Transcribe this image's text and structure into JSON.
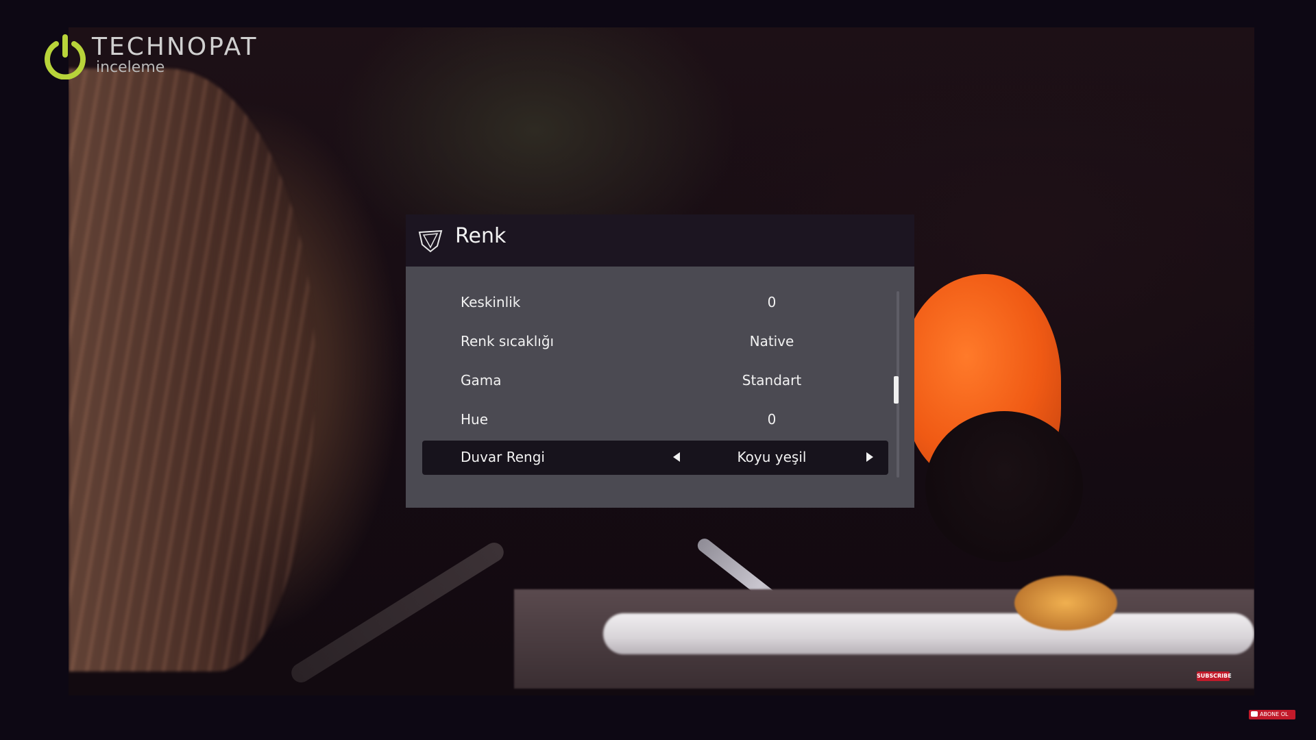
{
  "logo": {
    "brand": "TECHNOPAT",
    "sub": "inceleme",
    "accent_color": "#b8d43a",
    "icon": "power-icon"
  },
  "menu": {
    "title": "Renk",
    "icon": "shield-icon",
    "items": [
      {
        "label": "Keskinlik",
        "value": "0"
      },
      {
        "label": "Renk sıcaklığı",
        "value": "Native"
      },
      {
        "label": "Gama",
        "value": "Standart"
      },
      {
        "label": "Hue",
        "value": "0"
      },
      {
        "label": "Duvar Rengi",
        "value": "Koyu yeşil",
        "selected": true
      }
    ]
  },
  "badges": {
    "subscribe": "SUBSCRIBE",
    "abone": "ABONE OL"
  },
  "colors": {
    "header_bg": "#1c1521",
    "body_bg": "#4b4a52",
    "selected_bg": "#17131c",
    "text": "#f2f2f2"
  }
}
